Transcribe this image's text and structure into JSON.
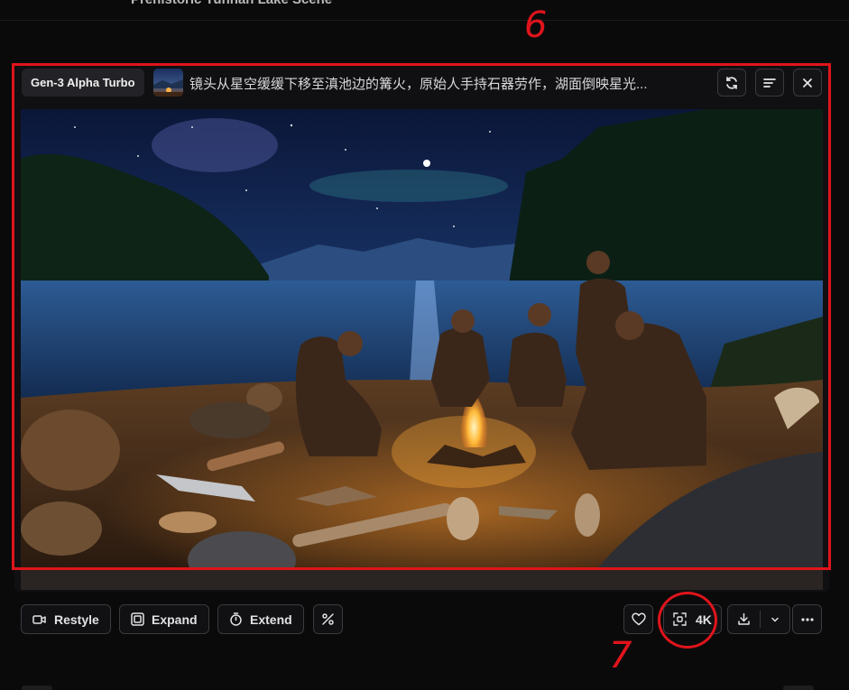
{
  "page": {
    "title": "Prehistoric Yunnan Lake Scene",
    "more_label": "···"
  },
  "card": {
    "model_badge": "Gen-3 Alpha Turbo",
    "prompt": "镜头从星空缓缓下移至滇池边的篝火，原始人手持石器劳作，湖面倒映星光...",
    "header_icons": [
      "refresh-icon",
      "menu-lines-icon",
      "close-icon"
    ],
    "preview_alt": "Prehistoric people gathered around a campfire by a starlit lake at night, with stone tools scattered on the shore"
  },
  "toolbar": {
    "restyle_label": "Restyle",
    "expand_label": "Expand",
    "extend_label": "Extend",
    "upscale_label": "4K"
  },
  "annotations": {
    "box_label": "6",
    "circle_label": "7",
    "color": "#e0141b"
  },
  "colors": {
    "background": "#0a0a0b",
    "card": "#101012",
    "button_border": "#3a3a3f",
    "text": "#e2e2e4"
  }
}
